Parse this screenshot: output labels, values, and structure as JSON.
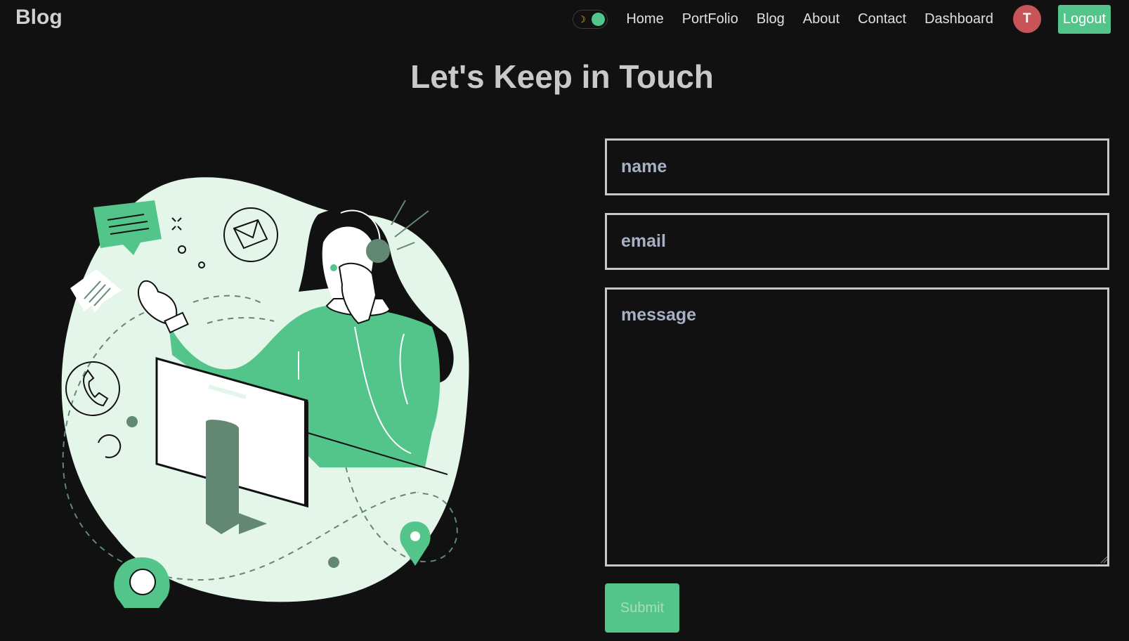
{
  "brand": "Blog",
  "nav": {
    "theme_toggle_icon": "moon-icon",
    "links": [
      "Home",
      "PortFolio",
      "Blog",
      "About",
      "Contact",
      "Dashboard"
    ],
    "avatar_initial": "T",
    "logout_label": "Logout"
  },
  "page_title": "Let's Keep in Touch",
  "form": {
    "name_placeholder": "name",
    "email_placeholder": "email",
    "message_placeholder": "message",
    "submit_label": "Submit"
  },
  "colors": {
    "background": "#111111",
    "accent": "#53c58a",
    "avatar": "#c75456",
    "illustration_blob": "#e4f5ea",
    "illustration_dark": "#628874"
  }
}
